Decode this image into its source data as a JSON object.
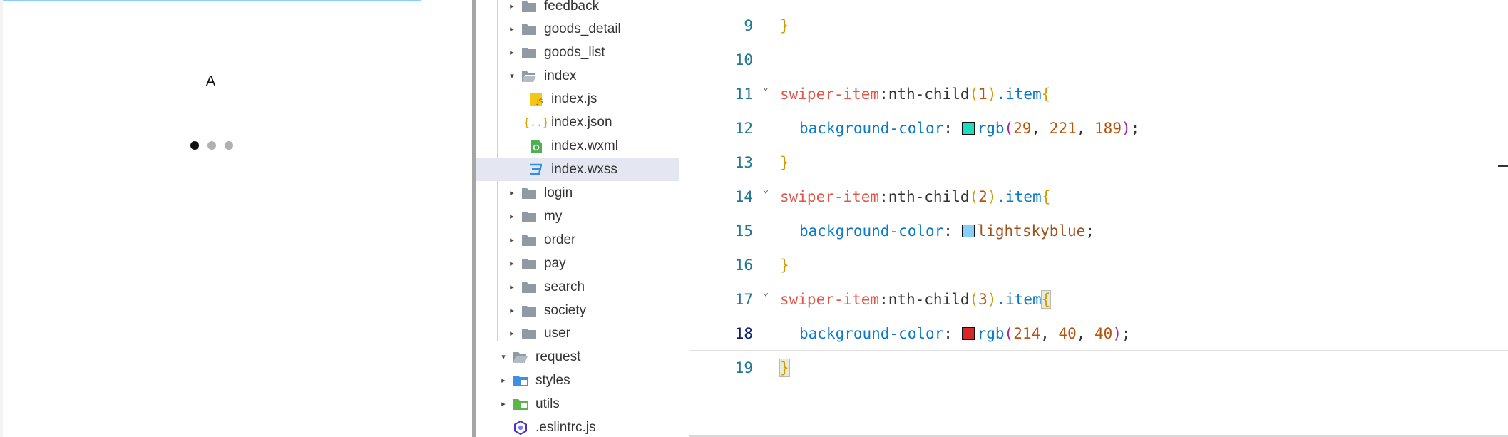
{
  "simulator": {
    "slide_text": "A",
    "dots": [
      true,
      false,
      false
    ]
  },
  "explorer": {
    "items": [
      {
        "label": "feedback",
        "icon": "folder-icon",
        "twisty": "▸"
      },
      {
        "label": "goods_detail",
        "icon": "folder-icon",
        "twisty": "▸"
      },
      {
        "label": "goods_list",
        "icon": "folder-icon",
        "twisty": "▸"
      },
      {
        "label": "index",
        "icon": "folder-open-icon",
        "twisty": "▾"
      },
      {
        "label": "index.js",
        "icon": "js-file-icon"
      },
      {
        "label": "index.json",
        "icon": "json-file-icon"
      },
      {
        "label": "index.wxml",
        "icon": "wxml-file-icon"
      },
      {
        "label": "index.wxss",
        "icon": "css-file-icon"
      },
      {
        "label": "login",
        "icon": "folder-icon",
        "twisty": "▸"
      },
      {
        "label": "my",
        "icon": "folder-icon",
        "twisty": "▸"
      },
      {
        "label": "order",
        "icon": "folder-icon",
        "twisty": "▸"
      },
      {
        "label": "pay",
        "icon": "folder-icon",
        "twisty": "▸"
      },
      {
        "label": "search",
        "icon": "folder-icon",
        "twisty": "▸"
      },
      {
        "label": "society",
        "icon": "folder-icon",
        "twisty": "▸"
      },
      {
        "label": "user",
        "icon": "folder-icon",
        "twisty": "▸"
      },
      {
        "label": "request",
        "icon": "folder-open-icon",
        "twisty": "▾"
      },
      {
        "label": "styles",
        "icon": "styles-folder-icon",
        "twisty": "▸"
      },
      {
        "label": "utils",
        "icon": "utils-folder-icon",
        "twisty": "▸"
      },
      {
        "label": ".eslintrc.js",
        "icon": "eslint-file-icon"
      }
    ],
    "selected": "index.wxss"
  },
  "editor": {
    "lines": [
      {
        "n": "9",
        "text": "}"
      },
      {
        "n": "10",
        "text": ""
      },
      {
        "n": "11",
        "selector": "swiper-item",
        "pseudo": ":nth-child",
        "open_paren": "(",
        "arg": "1",
        "close_paren": ")",
        "cls": ".item",
        "brace": "{"
      },
      {
        "n": "12",
        "prop": "background-color",
        "colon": ":",
        "swatch": "#1DDDBD",
        "fn": "rgb",
        "args_open": "(",
        "a1": "29",
        "a2": "221",
        "a3": "189",
        "args_close": ")",
        "semi": ";"
      },
      {
        "n": "13",
        "text": "}"
      },
      {
        "n": "14",
        "selector": "swiper-item",
        "pseudo": ":nth-child",
        "open_paren": "(",
        "arg": "2",
        "close_paren": ")",
        "cls": ".item",
        "brace": "{"
      },
      {
        "n": "15",
        "prop": "background-color",
        "colon": ":",
        "swatch": "#87CEFA",
        "value": "lightskyblue",
        "semi": ";"
      },
      {
        "n": "16",
        "text": "}"
      },
      {
        "n": "17",
        "selector": "swiper-item",
        "pseudo": ":nth-child",
        "open_paren": "(",
        "arg": "3",
        "close_paren": ")",
        "cls": ".item",
        "brace": "{"
      },
      {
        "n": "18",
        "prop": "background-color",
        "colon": ":",
        "swatch": "#D62828",
        "fn": "rgb",
        "args_open": "(",
        "a1": "214",
        "a2": "40",
        "a3": "40",
        "args_close": ")",
        "semi": ";"
      },
      {
        "n": "19",
        "text": "}"
      }
    ],
    "colors": {
      "selector": "#e45649",
      "pseudo": "#333333",
      "paren": "#d19a00",
      "number": "#b5520c",
      "class": "#0b7bc7",
      "property": "#0b7bc7",
      "brace": "#d19a00",
      "value_word": "#a0521c",
      "rgb_paren": "#a626a4"
    }
  }
}
